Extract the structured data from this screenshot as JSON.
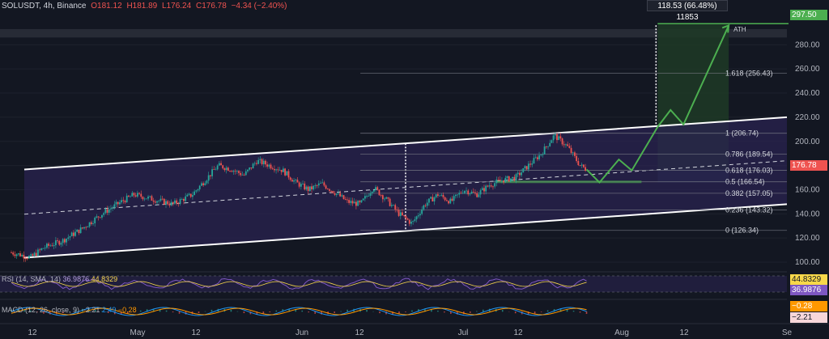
{
  "header": {
    "symbol": "SOLUSDT, 4h, Binance",
    "open": "O181.12",
    "high": "H181.89",
    "low": "L176.24",
    "close": "C176.78",
    "change": "−4.34 (−2.40%)"
  },
  "projection_label": "118.53 (66.48%) 11853",
  "ath_label": "ATH",
  "price_tags": {
    "target": "297.50",
    "current": "176.78",
    "rsi_value": "44.8329",
    "rsi_ma": "36.9876",
    "macd_value": "−0.28",
    "macd_signal": "−2.21"
  },
  "rsi_legend": {
    "name": "RSI (14, SMA, 14)",
    "value1": "36.9876",
    "value2": "44.8329"
  },
  "macd_legend": {
    "name": "MACD (12, 26, close, 9)",
    "value1": "−2.21",
    "value2": "2.49",
    "value3": "−0.28"
  },
  "colors": {
    "background": "#131722",
    "channel_fill": "#2a2350",
    "target_fill": "#1f3a26",
    "projection_line": "#4caf50",
    "up_candle": "#26a69a",
    "down_candle": "#ef5350",
    "rsi_line": "#7e57c2",
    "rsi_ma": "#f7d84a"
  },
  "chart_data": {
    "type": "candlestick",
    "title": "SOLUSDT, 4h, Binance",
    "y_axis": {
      "ticks": [
        100,
        120,
        140,
        160,
        180,
        200,
        220,
        240,
        260,
        280
      ],
      "tick_labels": [
        "100.00",
        "120.00",
        "140.00",
        "160.00",
        "180.00",
        "200.00",
        "220.00",
        "240.00",
        "260.00",
        "280.00"
      ],
      "range": [
        94,
        305
      ]
    },
    "x_axis": {
      "tick_labels": [
        "12",
        "May",
        "12",
        "Jun",
        "12",
        "Jul",
        "12",
        "Aug",
        "12",
        "Se"
      ]
    },
    "fibonacci": [
      {
        "label": "0 (126.34)",
        "value": 126.34
      },
      {
        "label": "0.236 (143.32)",
        "value": 143.32
      },
      {
        "label": "0.382 (157.05)",
        "value": 157.05
      },
      {
        "label": "0.5 (166.54)",
        "value": 166.54
      },
      {
        "label": "0.618 (176.03)",
        "value": 176.03
      },
      {
        "label": "0.786 (189.54)",
        "value": 189.54
      },
      {
        "label": "1 (206.74)",
        "value": 206.74
      },
      {
        "label": "1.618 (256.43)",
        "value": 256.43
      }
    ],
    "price_path": [
      {
        "t": 0,
        "p": 108
      },
      {
        "t": 6,
        "p": 104
      },
      {
        "t": 10,
        "p": 112
      },
      {
        "t": 16,
        "p": 118
      },
      {
        "t": 22,
        "p": 128
      },
      {
        "t": 28,
        "p": 140
      },
      {
        "t": 34,
        "p": 150
      },
      {
        "t": 38,
        "p": 156
      },
      {
        "t": 44,
        "p": 152
      },
      {
        "t": 50,
        "p": 148
      },
      {
        "t": 56,
        "p": 156
      },
      {
        "t": 60,
        "p": 168
      },
      {
        "t": 64,
        "p": 180
      },
      {
        "t": 68,
        "p": 177
      },
      {
        "t": 72,
        "p": 172
      },
      {
        "t": 76,
        "p": 184
      },
      {
        "t": 80,
        "p": 180
      },
      {
        "t": 84,
        "p": 176
      },
      {
        "t": 88,
        "p": 166
      },
      {
        "t": 92,
        "p": 160
      },
      {
        "t": 96,
        "p": 165
      },
      {
        "t": 100,
        "p": 158
      },
      {
        "t": 104,
        "p": 150
      },
      {
        "t": 108,
        "p": 148
      },
      {
        "t": 112,
        "p": 162
      },
      {
        "t": 116,
        "p": 152
      },
      {
        "t": 120,
        "p": 140
      },
      {
        "t": 124,
        "p": 132
      },
      {
        "t": 128,
        "p": 148
      },
      {
        "t": 132,
        "p": 156
      },
      {
        "t": 136,
        "p": 150
      },
      {
        "t": 140,
        "p": 160
      },
      {
        "t": 144,
        "p": 156
      },
      {
        "t": 148,
        "p": 164
      },
      {
        "t": 152,
        "p": 168
      },
      {
        "t": 156,
        "p": 170
      },
      {
        "t": 160,
        "p": 180
      },
      {
        "t": 164,
        "p": 190
      },
      {
        "t": 168,
        "p": 205
      },
      {
        "t": 172,
        "p": 196
      },
      {
        "t": 176,
        "p": 180
      },
      {
        "t": 178,
        "p": 176.78
      }
    ],
    "channel": {
      "upper": [
        {
          "t": 0,
          "p": 176
        },
        {
          "t": 240,
          "p": 220
        }
      ],
      "lower": [
        {
          "t": 0,
          "p": 103
        },
        {
          "t": 240,
          "p": 148
        }
      ],
      "mid": [
        {
          "t": 0,
          "p": 139
        },
        {
          "t": 240,
          "p": 184
        }
      ]
    },
    "projection": [
      {
        "t": 178,
        "p": 176.78
      },
      {
        "t": 182,
        "p": 166
      },
      {
        "t": 188,
        "p": 185
      },
      {
        "t": 192,
        "p": 176
      },
      {
        "t": 200,
        "p": 212
      },
      {
        "t": 204,
        "p": 226
      },
      {
        "t": 208,
        "p": 214
      },
      {
        "t": 222,
        "p": 296
      }
    ],
    "target": {
      "from": 176.78,
      "to": 297.5,
      "change": 118.53,
      "percent": 66.48
    },
    "indicators": {
      "rsi": {
        "period": 14,
        "value": 36.9876,
        "ma": 44.8329
      },
      "macd": {
        "fast": 12,
        "slow": 26,
        "signal": 9,
        "macd": -2.21,
        "signal_value": 2.49,
        "histogram": -0.28
      }
    }
  }
}
